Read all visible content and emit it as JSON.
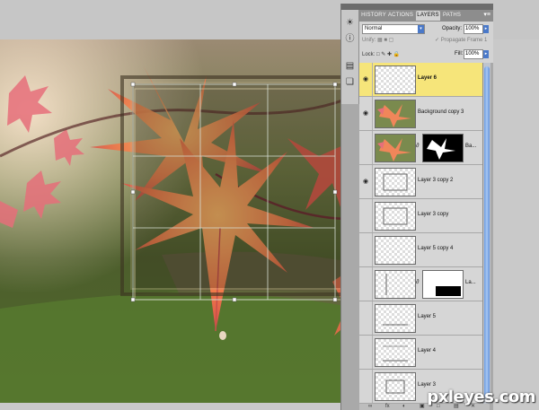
{
  "panel": {
    "tabs": [
      "HISTORY",
      "ACTIONS",
      "LAYERS",
      "PATHS"
    ],
    "active_tab": "LAYERS",
    "menu_glyph": "▾≡"
  },
  "options": {
    "blend_mode": "Normal",
    "opacity_label": "Opacity:",
    "opacity_value": "100%",
    "unify_label": "Unify:",
    "propagate_label": "Propagate Frame 1",
    "lock_label": "Lock:",
    "fill_label": "Fill:",
    "fill_value": "100%"
  },
  "layers": [
    {
      "name": "Layer 6",
      "visible": true,
      "selected": true,
      "thumb": "transparent"
    },
    {
      "name": "Background copy 3",
      "visible": true,
      "selected": false,
      "thumb": "leaf"
    },
    {
      "name": "Ba...",
      "visible": false,
      "selected": false,
      "thumb": "leaf",
      "mask": "leaf-mask"
    },
    {
      "name": "Layer 3 copy 2",
      "visible": true,
      "selected": false,
      "thumb": "frame"
    },
    {
      "name": "Layer 3 copy",
      "visible": false,
      "selected": false,
      "thumb": "frame"
    },
    {
      "name": "Layer 5 copy 4",
      "visible": false,
      "selected": false,
      "thumb": "transparent"
    },
    {
      "name": "La...",
      "visible": false,
      "selected": false,
      "thumb": "line-v",
      "mask": "black-bar"
    },
    {
      "name": "Layer 5",
      "visible": false,
      "selected": false,
      "thumb": "line-h"
    },
    {
      "name": "Layer 4",
      "visible": false,
      "selected": false,
      "thumb": "line-h2"
    },
    {
      "name": "Layer 3",
      "visible": false,
      "selected": false,
      "thumb": "frame-small"
    }
  ],
  "bottom_bar": [
    "∞",
    "fx",
    "◐",
    "▣",
    "□",
    "▤",
    "✕"
  ],
  "watermark": "pxleyes.com",
  "colors": {
    "selected_layer": "#f6e57a",
    "scroll_accent": "#6c9be0"
  }
}
